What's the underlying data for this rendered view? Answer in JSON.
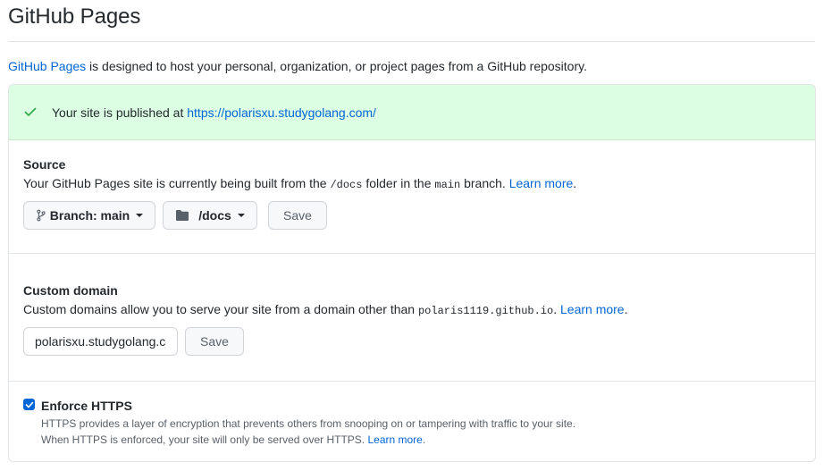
{
  "page": {
    "title": "GitHub Pages",
    "intro_link": "GitHub Pages",
    "intro_text": " is designed to host your personal, organization, or project pages from a GitHub repository."
  },
  "flash": {
    "text": "Your site is published at ",
    "url": "https://polarisxu.studygolang.com/",
    "color": "#dcffe4"
  },
  "source": {
    "title": "Source",
    "desc_1": "Your GitHub Pages site is currently being built from the ",
    "folder_code": "/docs",
    "desc_2": " folder in the ",
    "branch_code": "main",
    "desc_3": " branch. ",
    "learn_more": "Learn more",
    "desc_end": ".",
    "branch_button": "Branch: main",
    "folder_button": "/docs",
    "save_button": "Save"
  },
  "custom_domain": {
    "title": "Custom domain",
    "desc_1": "Custom domains allow you to serve your site from a domain other than ",
    "domain_code": "polaris1119.github.io",
    "desc_2": ". ",
    "learn_more": "Learn more",
    "desc_end": ".",
    "input_value": "polarisxu.studygolang.com",
    "save_button": "Save"
  },
  "https": {
    "title": "Enforce HTTPS",
    "checked": true,
    "note_1": "HTTPS provides a layer of encryption that prevents others from snooping on or tampering with traffic to your site.",
    "note_2": "When HTTPS is enforced, your site will only be served over HTTPS. ",
    "learn_more": "Learn more",
    "note_end": "."
  },
  "colors": {
    "link": "#0366d6",
    "border": "#e1e4e8",
    "success_bg": "#dcffe4"
  }
}
